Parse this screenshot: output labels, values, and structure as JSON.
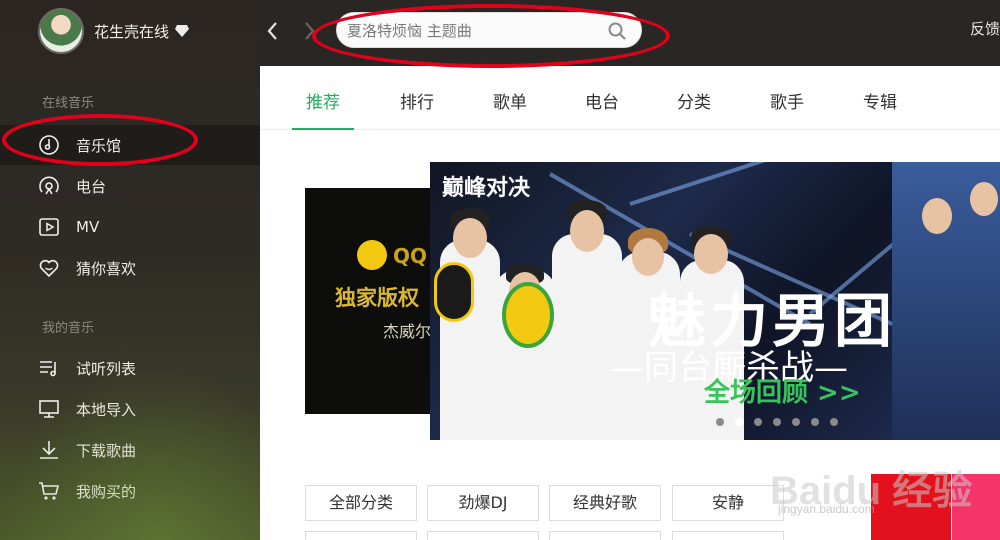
{
  "user": {
    "name": "花生壳在线",
    "vip_icon": "diamond-icon"
  },
  "sidebar": {
    "sections": [
      {
        "title": "在线音乐",
        "items": [
          {
            "label": "音乐馆",
            "icon": "music-note-icon",
            "active": true
          },
          {
            "label": "电台",
            "icon": "radio-icon"
          },
          {
            "label": "MV",
            "icon": "video-icon"
          },
          {
            "label": "猜你喜欢",
            "icon": "heart-icon"
          }
        ]
      },
      {
        "title": "我的音乐",
        "items": [
          {
            "label": "试听列表",
            "icon": "playlist-icon"
          },
          {
            "label": "本地导入",
            "icon": "monitor-icon"
          },
          {
            "label": "下载歌曲",
            "icon": "download-icon"
          },
          {
            "label": "我购买的",
            "icon": "cart-icon"
          }
        ]
      }
    ]
  },
  "topbar": {
    "back_icon": "chevron-left-icon",
    "forward_icon": "chevron-right-icon",
    "search": {
      "placeholder": "夏洛特烦恼 主题曲",
      "value": ""
    },
    "feedback": "反馈"
  },
  "tabs": [
    "推荐",
    "排行",
    "歌单",
    "电台",
    "分类",
    "歌手",
    "专辑"
  ],
  "active_tab": 0,
  "banner_back": {
    "brand": "QQ",
    "line1": "独家版权",
    "line2": "杰威尔"
  },
  "banner": {
    "logo": "巅峰对决",
    "headline": "魅力男团",
    "subline": "—同台厮杀战—",
    "cta": "全场回顾 >>",
    "slide_count": 7,
    "active_slide": 1
  },
  "categories": [
    "全部分类",
    "劲爆DJ",
    "经典好歌",
    "安静"
  ],
  "watermark": {
    "text": "Baidu 经验",
    "sub": "jingyan.baidu.com"
  },
  "colors": {
    "accent": "#1fad5f",
    "annotation": "#e3001b",
    "sidebar_bg": "#2b2622"
  }
}
